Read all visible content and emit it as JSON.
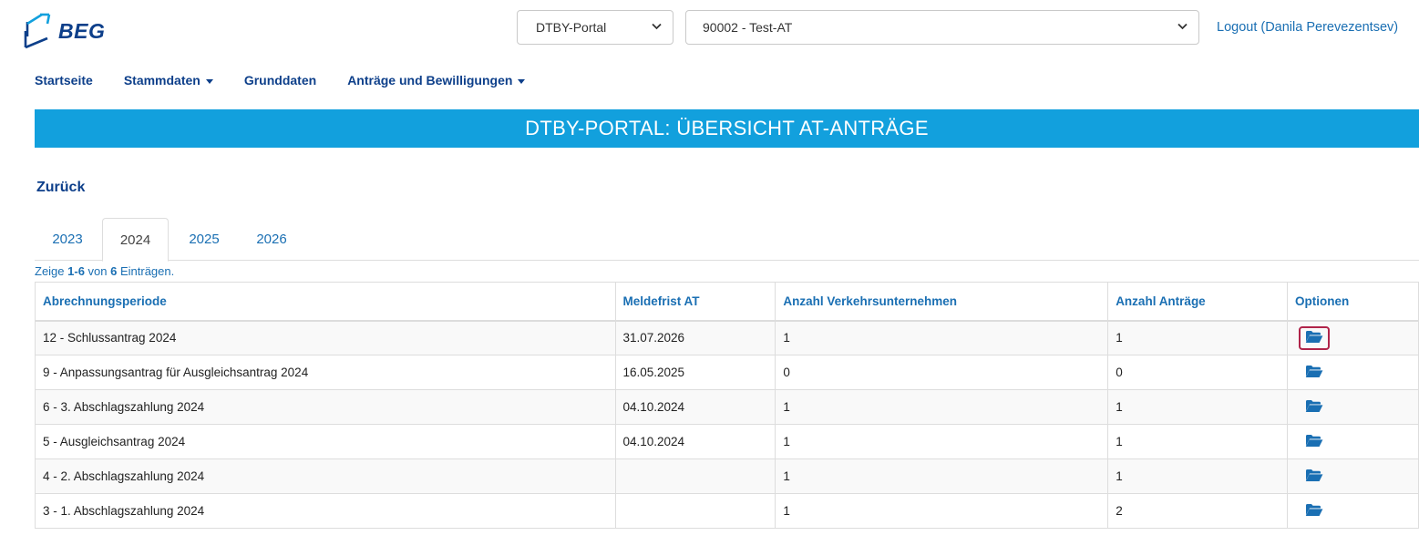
{
  "header": {
    "logo_text": "BEG",
    "portal_select": {
      "value": "DTBY-Portal"
    },
    "org_select": {
      "value": "90002 - Test-AT"
    },
    "logout_label": "Logout (Danila Perevezentsev)"
  },
  "nav": {
    "items": [
      {
        "label": "Startseite",
        "has_caret": false
      },
      {
        "label": "Stammdaten",
        "has_caret": true
      },
      {
        "label": "Grunddaten",
        "has_caret": false
      },
      {
        "label": "Anträge und Bewilligungen",
        "has_caret": true
      }
    ]
  },
  "banner": {
    "title": "DTBY-PORTAL: ÜBERSICHT AT-ANTRÄGE"
  },
  "back_label": "Zurück",
  "tabs": {
    "items": [
      "2023",
      "2024",
      "2025",
      "2026"
    ],
    "active": "2024"
  },
  "summary": {
    "prefix": "Zeige ",
    "range": "1-6",
    "middle": " von ",
    "total": "6",
    "suffix": " Einträgen."
  },
  "table": {
    "headers": {
      "period": "Abrechnungsperiode",
      "deadline": "Meldefrist AT",
      "companies": "Anzahl Verkehrsunternehmen",
      "applications": "Anzahl Anträge",
      "options": "Optionen"
    },
    "rows": [
      {
        "period": "12 - Schlussantrag 2024",
        "deadline": "31.07.2026",
        "companies": "1",
        "applications": "1"
      },
      {
        "period": "9 - Anpassungsantrag für Ausgleichsantrag 2024",
        "deadline": "16.05.2025",
        "companies": "0",
        "applications": "0"
      },
      {
        "period": "6 - 3. Abschlagszahlung 2024",
        "deadline": "04.10.2024",
        "companies": "1",
        "applications": "1"
      },
      {
        "period": "5 - Ausgleichsantrag 2024",
        "deadline": "04.10.2024",
        "companies": "1",
        "applications": "1"
      },
      {
        "period": "4 - 2. Abschlagszahlung 2024",
        "deadline": "",
        "companies": "1",
        "applications": "1"
      },
      {
        "period": "3 - 1. Abschlagszahlung 2024",
        "deadline": "",
        "companies": "1",
        "applications": "2"
      }
    ]
  },
  "icons": {
    "option_icon": "folder-open-icon",
    "logo_icon": "beg-logo-icon"
  },
  "colors": {
    "brand_dark": "#0d3f8a",
    "link": "#1a6fb3",
    "banner": "#12a0dd",
    "focus": "#b0244a"
  }
}
